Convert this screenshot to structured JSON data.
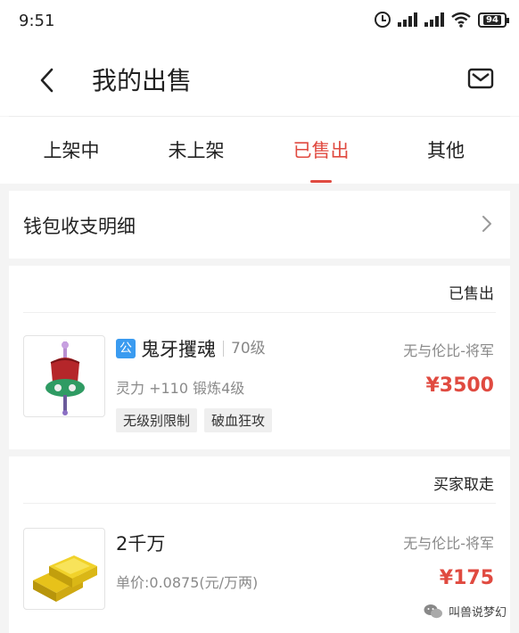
{
  "status_bar": {
    "time": "9:51",
    "battery": "94"
  },
  "nav": {
    "title": "我的出售"
  },
  "tabs": [
    {
      "label": "上架中",
      "active": false
    },
    {
      "label": "未上架",
      "active": false
    },
    {
      "label": "已售出",
      "active": true
    },
    {
      "label": "其他",
      "active": false
    }
  ],
  "wallet": {
    "label": "钱包收支明细"
  },
  "orders": [
    {
      "status": "已售出",
      "badge": "公",
      "name": "鬼牙攫魂",
      "level": "70级",
      "sub": "灵力 +110 锻炼4级",
      "tags": [
        "无级别限制",
        "破血狂攻"
      ],
      "seller": "无与伦比-将军",
      "price": "¥3500"
    },
    {
      "status": "买家取走",
      "name": "2千万",
      "sub": "单价:0.0875(元/万两)",
      "seller": "无与伦比-将军",
      "price": "¥175"
    }
  ],
  "watermark": {
    "text": "叫兽说梦幻"
  },
  "colors": {
    "accent": "#e04a40",
    "badge": "#3a9bf0"
  }
}
